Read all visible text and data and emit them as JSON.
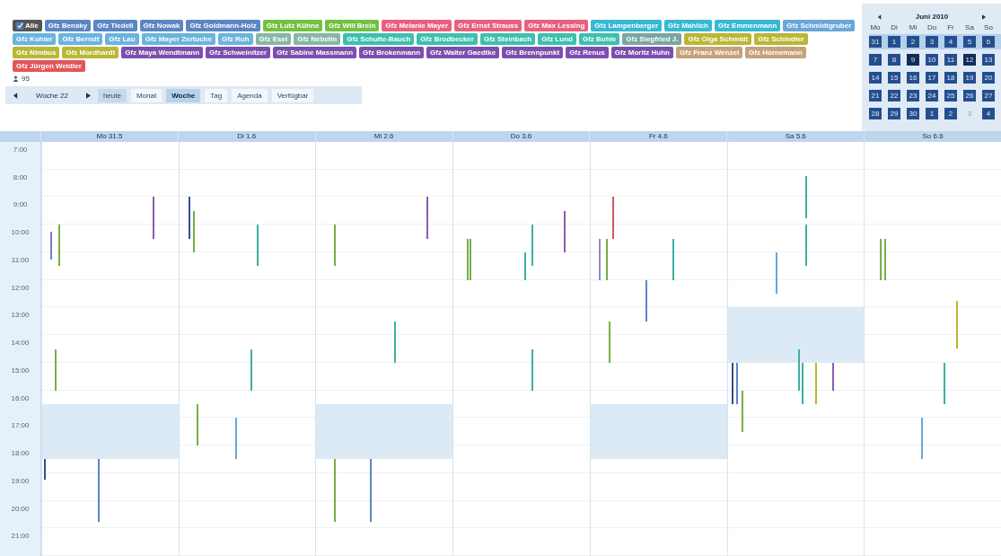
{
  "filters": {
    "all": {
      "label": "Alle",
      "checked": true
    },
    "tags": [
      {
        "label": "Gfz Bensky",
        "color": "#5b86c4"
      },
      {
        "label": "Gfz Tiedell",
        "color": "#5b86c4"
      },
      {
        "label": "Gfz Nowak",
        "color": "#5b86c4"
      },
      {
        "label": "Gfz Goldmann-Holz",
        "color": "#5b86c4"
      },
      {
        "label": "Gfz Lutz Kühne",
        "color": "#74c043"
      },
      {
        "label": "Gfz Will Brein",
        "color": "#74c043"
      },
      {
        "label": "Gfz Melanie Mayer",
        "color": "#e9607e"
      },
      {
        "label": "Gfz Ernst Strauss",
        "color": "#e9607e"
      },
      {
        "label": "Gfz Max Lessing",
        "color": "#e9607e"
      },
      {
        "label": "Gfz Lampenberger",
        "color": "#36b9d3"
      },
      {
        "label": "Gfz Mahlich",
        "color": "#36b9d3"
      },
      {
        "label": "Gfz Emmenmann",
        "color": "#36b9d3"
      },
      {
        "label": "Gfz Schmidtgruber",
        "color": "#6aa6d8"
      },
      {
        "label": "Gfz Kohler",
        "color": "#6ab4de"
      },
      {
        "label": "Gfz Berndt",
        "color": "#6ab4de"
      },
      {
        "label": "Gfz Lau",
        "color": "#6ab4de"
      },
      {
        "label": "Gfz Mayer Zertuche",
        "color": "#6ab4de"
      },
      {
        "label": "Gfz Ruh",
        "color": "#6ab4de"
      },
      {
        "label": "Gfz Esel",
        "color": "#86b8a4"
      },
      {
        "label": "Gfz Nebelin",
        "color": "#86b8a4"
      },
      {
        "label": "Gfz Schulte-Bauch",
        "color": "#3cc0b0"
      },
      {
        "label": "Gfz Brodbecker",
        "color": "#3cc0b0"
      },
      {
        "label": "Gfz Steinbach",
        "color": "#3cc0b0"
      },
      {
        "label": "Gfz Lund",
        "color": "#3cc0b0"
      },
      {
        "label": "Gfz Bohle",
        "color": "#3cc0b0"
      },
      {
        "label": "Gfz Siegfried J.",
        "color": "#7aa6a2"
      },
      {
        "label": "Gfz Olga Schmidt",
        "color": "#b9b734"
      },
      {
        "label": "Gfz Schindler",
        "color": "#b9b734"
      },
      {
        "label": "Gfz Nimbus",
        "color": "#b9b734"
      },
      {
        "label": "Gfz Mordhardt",
        "color": "#b9b734"
      },
      {
        "label": "Gfz Maya Wendtmann",
        "color": "#7b4fae"
      },
      {
        "label": "Gfz Schweinitzer",
        "color": "#7b4fae"
      },
      {
        "label": "Gfz Sabine Massmann",
        "color": "#7b4fae"
      },
      {
        "label": "Gfz Brokenmann",
        "color": "#7b4fae"
      },
      {
        "label": "Gfz Walter Gaedtke",
        "color": "#7b4fae"
      },
      {
        "label": "Gfz Brennpunkt",
        "color": "#7b4fae"
      },
      {
        "label": "Gfz Renus",
        "color": "#7b4fae"
      },
      {
        "label": "Gfz Moritz Huhn",
        "color": "#7b4fae"
      },
      {
        "label": "Gfz Franz Wenzel",
        "color": "#c4a27c"
      },
      {
        "label": "Gfz Hornemann",
        "color": "#c4a27c"
      },
      {
        "label": "Gfz Jürgen Weidler",
        "color": "#e2555a"
      }
    ],
    "count": "95"
  },
  "minical": {
    "title": "Juni 2010",
    "weekdays": [
      "Mo",
      "Di",
      "Mi",
      "Do",
      "Fr",
      "Sa",
      "So"
    ],
    "weeks": [
      {
        "current": true,
        "days": [
          {
            "label": "31",
            "busy": true,
            "dark": false
          },
          {
            "label": "1",
            "busy": true,
            "dark": false
          },
          {
            "label": "2",
            "busy": true,
            "dark": false
          },
          {
            "label": "3",
            "busy": true,
            "dark": false
          },
          {
            "label": "4",
            "busy": true,
            "dark": false
          },
          {
            "label": "5",
            "busy": true,
            "dark": false
          },
          {
            "label": "6",
            "busy": true,
            "dark": false
          }
        ]
      },
      {
        "current": false,
        "days": [
          {
            "label": "7",
            "busy": true,
            "dark": false
          },
          {
            "label": "8",
            "busy": true,
            "dark": false
          },
          {
            "label": "9",
            "busy": true,
            "dark": true
          },
          {
            "label": "10",
            "busy": true,
            "dark": false
          },
          {
            "label": "11",
            "busy": true,
            "dark": false
          },
          {
            "label": "12",
            "busy": true,
            "dark": true
          },
          {
            "label": "13",
            "busy": true,
            "dark": false
          }
        ]
      },
      {
        "current": false,
        "days": [
          {
            "label": "14",
            "busy": true,
            "dark": false
          },
          {
            "label": "15",
            "busy": true,
            "dark": false
          },
          {
            "label": "16",
            "busy": true,
            "dark": false
          },
          {
            "label": "17",
            "busy": true,
            "dark": false
          },
          {
            "label": "18",
            "busy": true,
            "dark": false
          },
          {
            "label": "19",
            "busy": true,
            "dark": false
          },
          {
            "label": "20",
            "busy": true,
            "dark": false
          }
        ]
      },
      {
        "current": false,
        "days": [
          {
            "label": "21",
            "busy": true,
            "dark": false
          },
          {
            "label": "22",
            "busy": true,
            "dark": false
          },
          {
            "label": "23",
            "busy": true,
            "dark": false
          },
          {
            "label": "24",
            "busy": true,
            "dark": false
          },
          {
            "label": "25",
            "busy": true,
            "dark": false
          },
          {
            "label": "26",
            "busy": true,
            "dark": false
          },
          {
            "label": "27",
            "busy": true,
            "dark": false
          }
        ]
      },
      {
        "current": false,
        "days": [
          {
            "label": "28",
            "busy": true,
            "dark": false
          },
          {
            "label": "29",
            "busy": true,
            "dark": false
          },
          {
            "label": "30",
            "busy": true,
            "dark": false
          },
          {
            "label": "1",
            "busy": true,
            "dark": false
          },
          {
            "label": "2",
            "busy": true,
            "dark": false
          },
          {
            "label": "3",
            "busy": false,
            "dark": false
          },
          {
            "label": "4",
            "busy": true,
            "dark": false
          }
        ]
      }
    ]
  },
  "toolbar": {
    "period": "Woche 22",
    "today": "heute",
    "views": [
      {
        "label": "Monat",
        "selected": false
      },
      {
        "label": "Woche",
        "selected": true
      },
      {
        "label": "Tag",
        "selected": false
      },
      {
        "label": "Agenda",
        "selected": false
      },
      {
        "label": "Verfügbar",
        "selected": false
      }
    ]
  },
  "hours": [
    "7:00",
    "8:00",
    "9:00",
    "10:00",
    "11:00",
    "12:00",
    "13:00",
    "14:00",
    "15:00",
    "16:00",
    "17:00",
    "18:00",
    "19:00",
    "20:00",
    "21:00"
  ],
  "days": [
    {
      "label": "Mo 31.5",
      "blocked": true,
      "events": [
        {
          "color": "#7a80c0"
        },
        {
          "color": "#74b043"
        },
        {
          "color": "#74b043"
        },
        {
          "color": "#2e4e9a"
        },
        {
          "color": "#5b86c4"
        },
        {
          "color": "#8a5cb0"
        }
      ]
    },
    {
      "label": "Di 1.6",
      "blocked": false,
      "events": [
        {
          "color": "#2e4e9a"
        },
        {
          "color": "#74b043"
        },
        {
          "color": "#74b043"
        },
        {
          "color": "#6aa6d8"
        },
        {
          "color": "#3cb0a0"
        },
        {
          "color": "#3cb0a0"
        }
      ]
    },
    {
      "label": "Mi 2.6",
      "blocked": true,
      "events": [
        {
          "color": "#74b043"
        },
        {
          "color": "#74b043"
        },
        {
          "color": "#5b86c4"
        },
        {
          "color": "#3cb0a0"
        },
        {
          "color": "#8a5cb0"
        }
      ]
    },
    {
      "label": "Do 3.6",
      "blocked": false,
      "events": [
        {
          "color": "#74b043"
        },
        {
          "color": "#74b043"
        },
        {
          "color": "#3cb0a0"
        },
        {
          "color": "#3cb0a0"
        },
        {
          "color": "#3cb0a0"
        },
        {
          "color": "#8a5cb0"
        }
      ]
    },
    {
      "label": "Fr 4.6",
      "blocked": true,
      "events": [
        {
          "color": "#8a8ec8"
        },
        {
          "color": "#74b043"
        },
        {
          "color": "#74b043"
        },
        {
          "color": "#d05a60"
        },
        {
          "color": "#5b86c4"
        },
        {
          "color": "#3cb0a0"
        }
      ]
    },
    {
      "label": "Sa 5.6",
      "blocked": true,
      "events": [
        {
          "color": "#2e4e9a"
        },
        {
          "color": "#5b86c4"
        },
        {
          "color": "#74b043"
        },
        {
          "color": "#6aa6d8"
        },
        {
          "color": "#3cb0a0"
        },
        {
          "color": "#3cb0a0"
        },
        {
          "color": "#3cb0a0"
        },
        {
          "color": "#3cb0a0"
        },
        {
          "color": "#b9b734"
        },
        {
          "color": "#8a5cb0"
        }
      ]
    },
    {
      "label": "So 6.6",
      "blocked": false,
      "events": [
        {
          "color": "#74b043"
        },
        {
          "color": "#74b043"
        },
        {
          "color": "#6aa6d8"
        },
        {
          "color": "#3cb0a0"
        },
        {
          "color": "#b9b734"
        }
      ]
    }
  ]
}
